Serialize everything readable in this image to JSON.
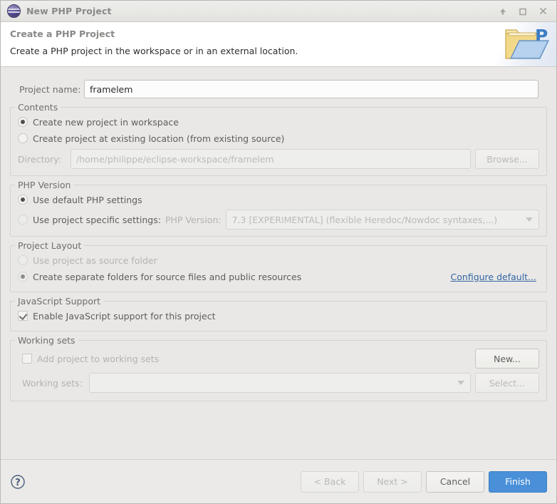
{
  "window": {
    "title": "New PHP Project",
    "icon": "php-elephant-icon",
    "controls": {
      "minimize": "minimize-icon",
      "maximize": "maximize-icon",
      "close": "close-icon"
    }
  },
  "header": {
    "title": "Create a PHP Project",
    "description": "Create a PHP project in the workspace or in an external location.",
    "graphic": "php-folder-icon"
  },
  "project_name": {
    "label": "Project name:",
    "value": "framelem",
    "placeholder": ""
  },
  "contents": {
    "legend": "Contents",
    "options": [
      {
        "label": "Create new project in workspace",
        "selected": true,
        "enabled": true
      },
      {
        "label": "Create project at existing location (from existing source)",
        "selected": false,
        "enabled": true
      }
    ],
    "directory": {
      "label": "Directory:",
      "value": "/home/philippe/eclipse-workspace/framelem",
      "enabled": false
    },
    "browse_button": {
      "label": "Browse...",
      "enabled": false
    }
  },
  "php_version": {
    "legend": "PHP Version",
    "options": [
      {
        "label": "Use default PHP settings",
        "selected": true,
        "enabled": true
      },
      {
        "label": "Use project specific settings:",
        "selected": false,
        "enabled": false
      }
    ],
    "version_label": "PHP Version:",
    "version_value": "7.3 [EXPERIMENTAL] (flexible Heredoc/Nowdoc syntaxes,...)",
    "version_enabled": false,
    "dropdown_icon": "chevron-down-icon"
  },
  "project_layout": {
    "legend": "Project Layout",
    "options": [
      {
        "label": "Use project as source folder",
        "selected": false,
        "enabled": false
      },
      {
        "label": "Create separate folders for source files and public resources",
        "selected": true,
        "enabled": false
      }
    ],
    "configure_link": "Configure default..."
  },
  "javascript_support": {
    "legend": "JavaScript Support",
    "checkbox": {
      "label": "Enable JavaScript support for this project",
      "checked": true,
      "enabled": true
    }
  },
  "working_sets": {
    "legend": "Working sets",
    "checkbox": {
      "label": "Add project to working sets",
      "checked": false,
      "enabled": false
    },
    "new_button": {
      "label": "New...",
      "enabled": true
    },
    "sets_label": "Working sets:",
    "sets_value": "",
    "sets_enabled": false,
    "select_button": {
      "label": "Select...",
      "enabled": false
    },
    "dropdown_icon": "chevron-down-icon"
  },
  "footer": {
    "help_icon": "help-question-icon",
    "buttons": [
      {
        "label": "< Back",
        "enabled": false,
        "primary": false
      },
      {
        "label": "Next >",
        "enabled": false,
        "primary": false
      },
      {
        "label": "Cancel",
        "enabled": true,
        "primary": false
      },
      {
        "label": "Finish",
        "enabled": true,
        "primary": true
      }
    ]
  },
  "colors": {
    "accent": "#4a90d9",
    "link": "#3465a4",
    "dialog_bg": "#e9e8e6",
    "header_bg": "#ffffff"
  }
}
